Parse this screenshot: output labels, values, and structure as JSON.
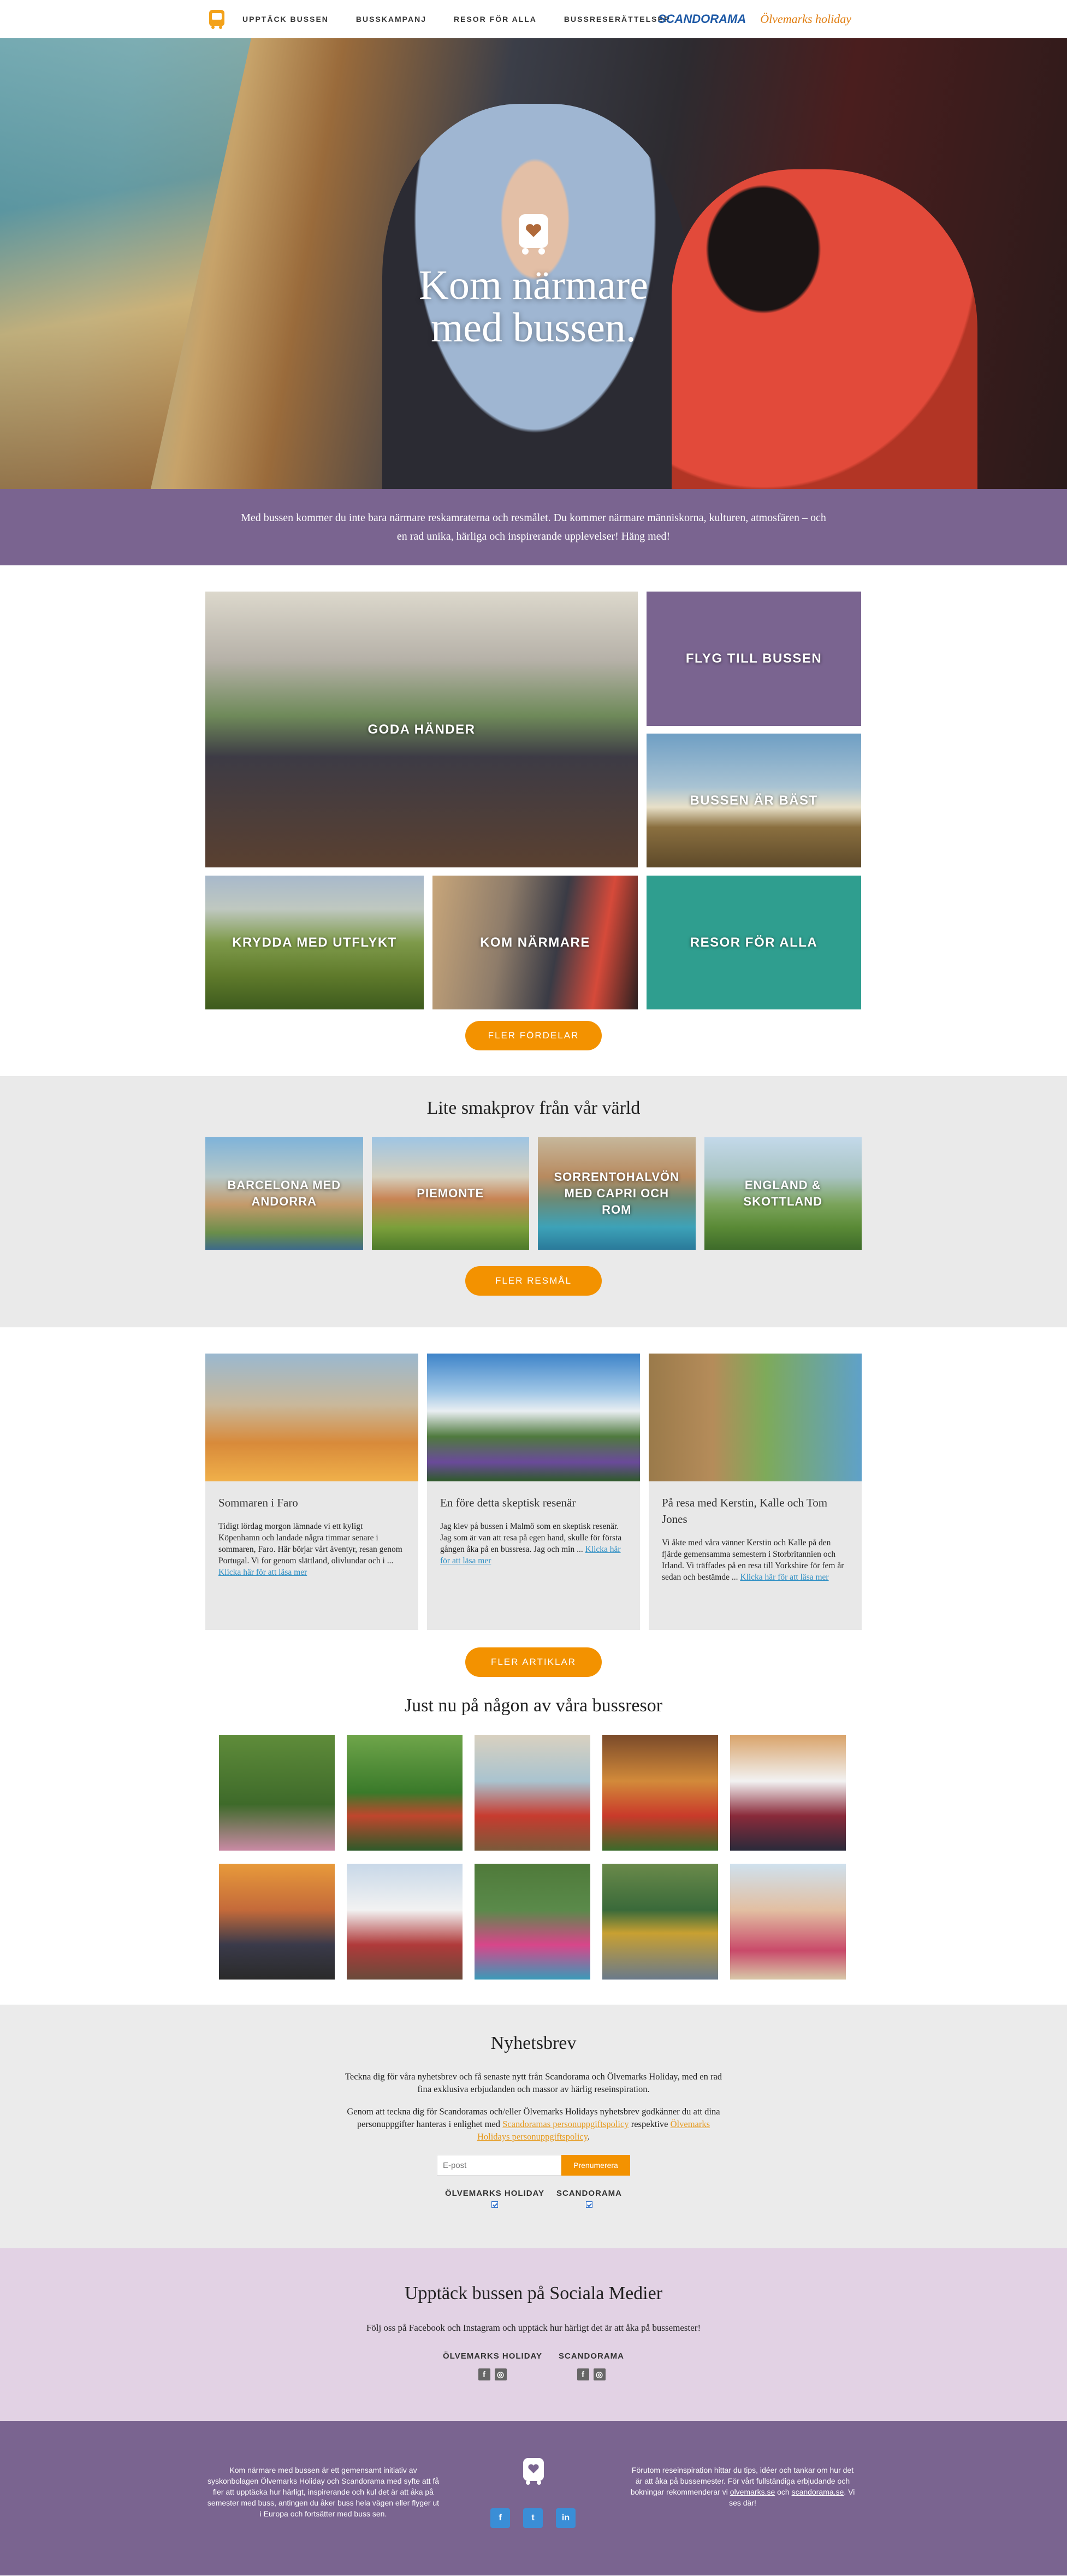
{
  "nav": {
    "links": [
      "UPPTÄCK BUSSEN",
      "BUSSKAMPANJ",
      "RESOR FÖR ALLA",
      "BUSSRESERÄTTELSER"
    ],
    "brand_scandorama": "SCANDORAMA",
    "brand_olvemarks": "Ölvemarks holiday"
  },
  "hero": {
    "title_line1": "Kom närmare",
    "title_line2": "med bussen."
  },
  "intro": {
    "text": "Med bussen kommer du inte bara närmare reskamraterna och resmålet. Du kommer närmare människorna, kulturen, atmosfären – och en rad unika, härliga och inspirerande upplevelser! Häng med!"
  },
  "tiles": {
    "goda_hander": "GODA HÄNDER",
    "flyg": "FLYG TILL BUSSEN",
    "bussen_ar_bast": "BUSSEN ÄR BÄST",
    "krydda": "KRYDDA MED UTFLYKT",
    "kom_narmare": "KOM NÄRMARE",
    "resor": "RESOR FÖR ALLA",
    "more_button": "FLER FÖRDELAR"
  },
  "destinations": {
    "title": "Lite smakprov från vår värld",
    "items": [
      "BARCELONA MED ANDORRA",
      "PIEMONTE",
      "SORRENTOHALVÖN MED CAPRI OCH ROM",
      "ENGLAND & SKOTTLAND"
    ],
    "more_button": "FLER RESMÅL"
  },
  "articles": {
    "items": [
      {
        "title": "Sommaren i Faro",
        "text": "Tidigt lördag morgon lämnade vi ett kyligt Köpenhamn och landade några timmar senare i sommaren, Faro. Här börjar vårt äventyr, resan genom Portugal. Vi for genom slättland, olivlundar och i ... ",
        "link": "Klicka här för att läsa mer"
      },
      {
        "title": "En före detta skeptisk resenär",
        "text": "Jag klev på bussen i Malmö som en skeptisk resenär. Jag som är van att resa på egen hand, skulle för första gången åka på en bussresa. Jag och min ... ",
        "link": "Klicka här för att läsa mer"
      },
      {
        "title": "På resa med Kerstin, Kalle och Tom Jones",
        "text": "Vi åkte med våra vänner Kerstin och Kalle på den fjärde gemensamma semestern i Storbritannien och Irland. Vi träffades på en resa till Yorkshire för fem år sedan och bestämde ... ",
        "link": "Klicka här för att läsa mer"
      }
    ],
    "more_button": "FLER ARTIKLAR"
  },
  "live": {
    "title": "Just nu på någon av våra bussresor"
  },
  "newsletter": {
    "title": "Nyhetsbrev",
    "text1": "Teckna dig för våra nyhetsbrev och få senaste nytt från Scandorama och Ölvemarks Holiday, med en rad fina exklusiva erbjudanden och massor av härlig reseinspiration.",
    "text2_a": "Genom att teckna dig för Scandoramas och/eller Ölvemarks Holidays nyhetsbrev godkänner du att dina personuppgifter hanteras i enlighet med ",
    "link1": "Scandoramas personuppgiftspolicy",
    "text2_b": " respektive ",
    "link2": "Ölvemarks Holidays personuppgiftspolicy",
    "text2_c": ".",
    "email_placeholder": "E-post",
    "submit": "Prenumerera",
    "check1": "ÖLVEMARKS HOLIDAY",
    "check2": "SCANDORAMA"
  },
  "social": {
    "title": "Upptäck bussen på Sociala Medier",
    "text": "Följ oss på Facebook och Instagram och upptäck hur härligt det är att åka på bussemester!",
    "col1": "ÖLVEMARKS HOLIDAY",
    "col2": "SCANDORAMA"
  },
  "footer": {
    "left": "Kom närmare med bussen är ett gemensamt initiativ av syskonbolagen Ölvemarks Holiday och Scandorama med syfte att få fler att upptäcka hur härligt, inspirerande och kul det är att åka på semester med buss, antingen du åker buss hela vägen eller flyger ut i Europa och fortsätter med buss sen.",
    "right_a": "Förutom reseinspiration hittar du tips, idéer och tankar om hur det är att åka på bussemester. För vårt fullständiga erbjudande och bokningar rekommenderar vi ",
    "right_link1": "olvemarks.se",
    "right_b": " och ",
    "right_link2": "scandorama.se",
    "right_c": ". Vi ses där!"
  },
  "colors": {
    "purple": "#7a6490",
    "orange": "#f39200",
    "teal": "#2f9e8f",
    "light_gray": "#ebebeb",
    "lilac": "#e2d2e4"
  }
}
